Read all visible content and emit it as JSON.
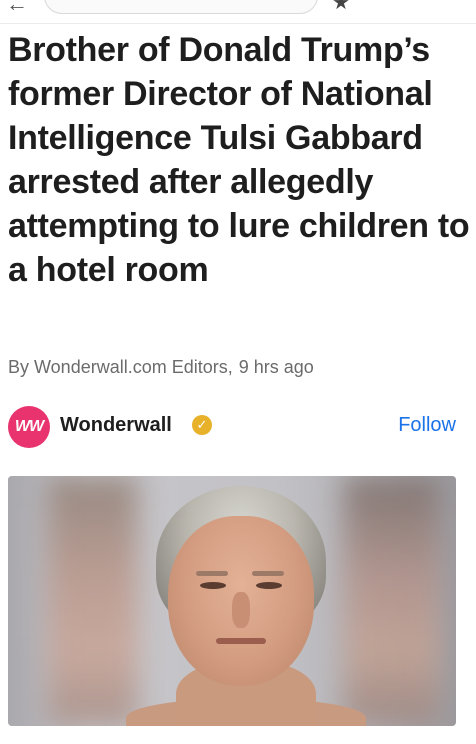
{
  "browser": {
    "back_glyph": "←",
    "star_glyph": "★",
    "more_glyph": "•••"
  },
  "article": {
    "headline": "Brother of Donald Trump’s former Director of National Intelligence Tulsi Gabbard arrested after allegedly attempting to lure children to a hotel room",
    "byline_author": "By Wonderwall.com Editors,",
    "byline_time": "9 hrs ago"
  },
  "publisher": {
    "logo_text": "WW",
    "name": "Wonderwall",
    "verified_glyph": "✓",
    "follow_label": "Follow",
    "logo_color": "#e8336f",
    "follow_color": "#1a73e8",
    "verified_color": "#e7b12a"
  },
  "image": {
    "alt": "Mugshot photo"
  }
}
